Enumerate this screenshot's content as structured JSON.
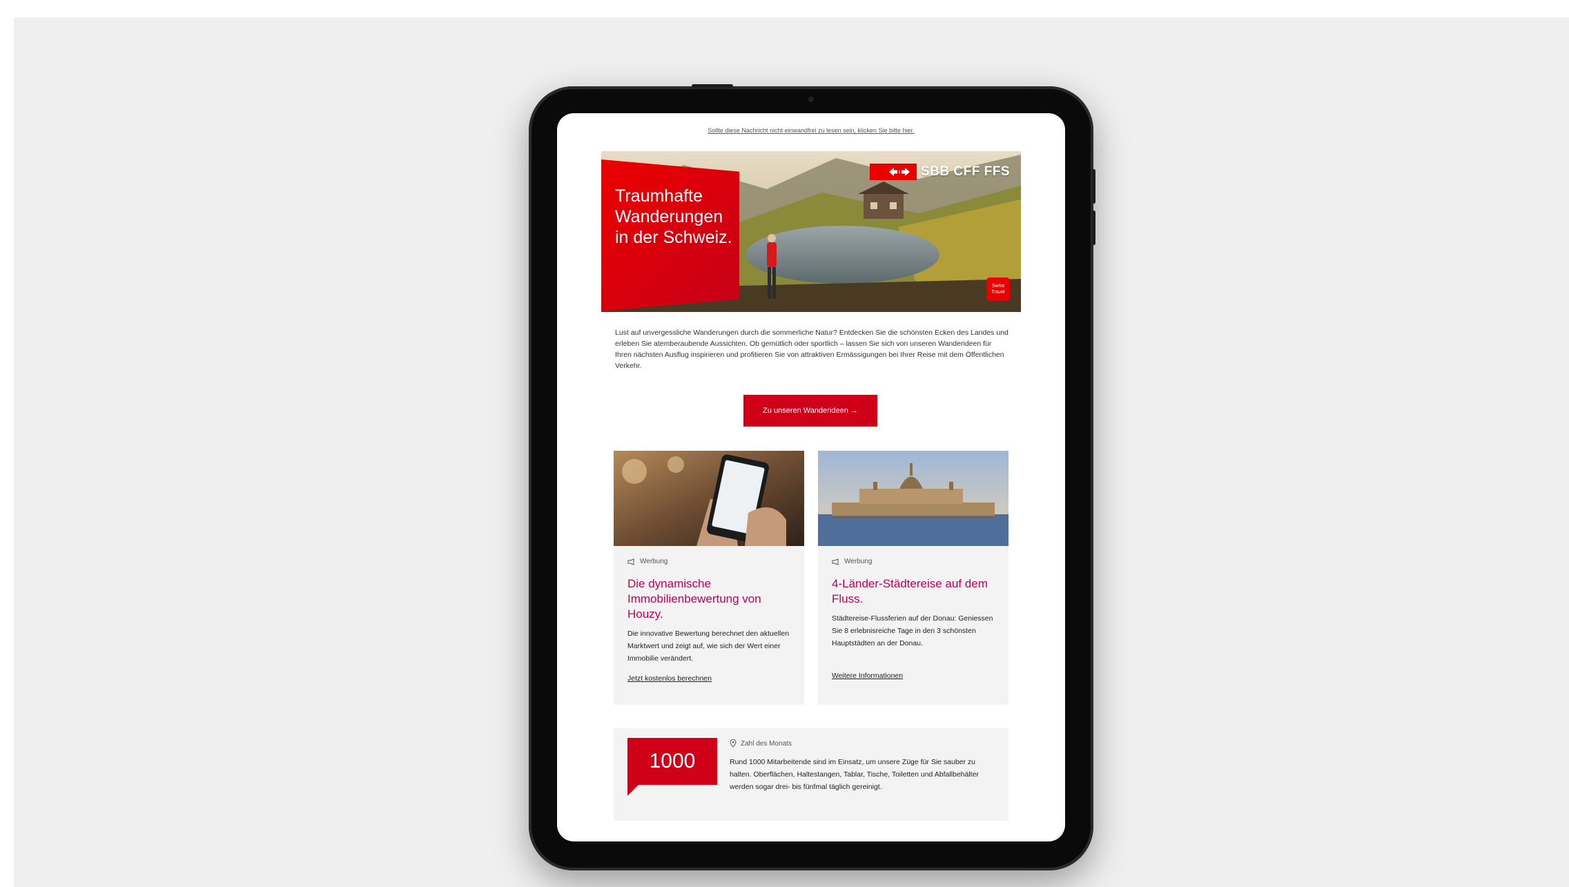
{
  "email": {
    "preheader": "Sollte diese Nachricht nicht einwandfrei zu lesen sein, klicken Sie bitte hier.",
    "hero": {
      "title": "Traumhafte\nWanderungen\nin der Schweiz.",
      "brand": "SBB CFF FFS",
      "badge": "Swiss Travel"
    },
    "intro": "Lust auf unvergessliche Wanderungen durch die sommerliche Natur? Entdecken Sie die schönsten Ecken des Landes und erleben Sie atemberaubende Aussichten. Ob gemütlich oder sportlich – lassen Sie sich von unseren Wanderideen für Ihren nächsten Ausflug inspirieren und profitieren Sie von attraktiven Ermässigungen bei Ihrer Reise mit dem Öffentlichen Verkehr.",
    "cta_label": "Zu unseren Wanderideen →",
    "cards": [
      {
        "tag": "Werbung",
        "title": "Die dynamische Immobilienbewertung von Houzy.",
        "text": "Die innovative Bewertung berechnet den aktuellen Marktwert und zeigt auf, wie sich der Wert einer Immobilie verändert.",
        "link": "Jetzt kostenlos berechnen"
      },
      {
        "tag": "Werbung",
        "title": "4-Länder-Städtereise auf dem Fluss.",
        "text": "Städtereise-Flussferien auf der Donau: Geniessen Sie 8 erlebnisreiche Tage in den 3 schönsten Hauptstädten an der Donau.",
        "link": "Weitere Informationen"
      }
    ],
    "fact": {
      "number": "1000",
      "tag": "Zahl des Monats",
      "text": "Rund 1000 Mitarbeitende sind im Einsatz, um unsere Züge für Sie sauber zu halten. Oberflächen, Haltestangen, Tablar, Tische, Toiletten und Abfallbehälter werden sogar drei- bis fünfmal täglich gereinigt."
    }
  },
  "colors": {
    "sbb_red": "#eb0000",
    "cta_red": "#d00018",
    "card_title": "#c60050"
  }
}
